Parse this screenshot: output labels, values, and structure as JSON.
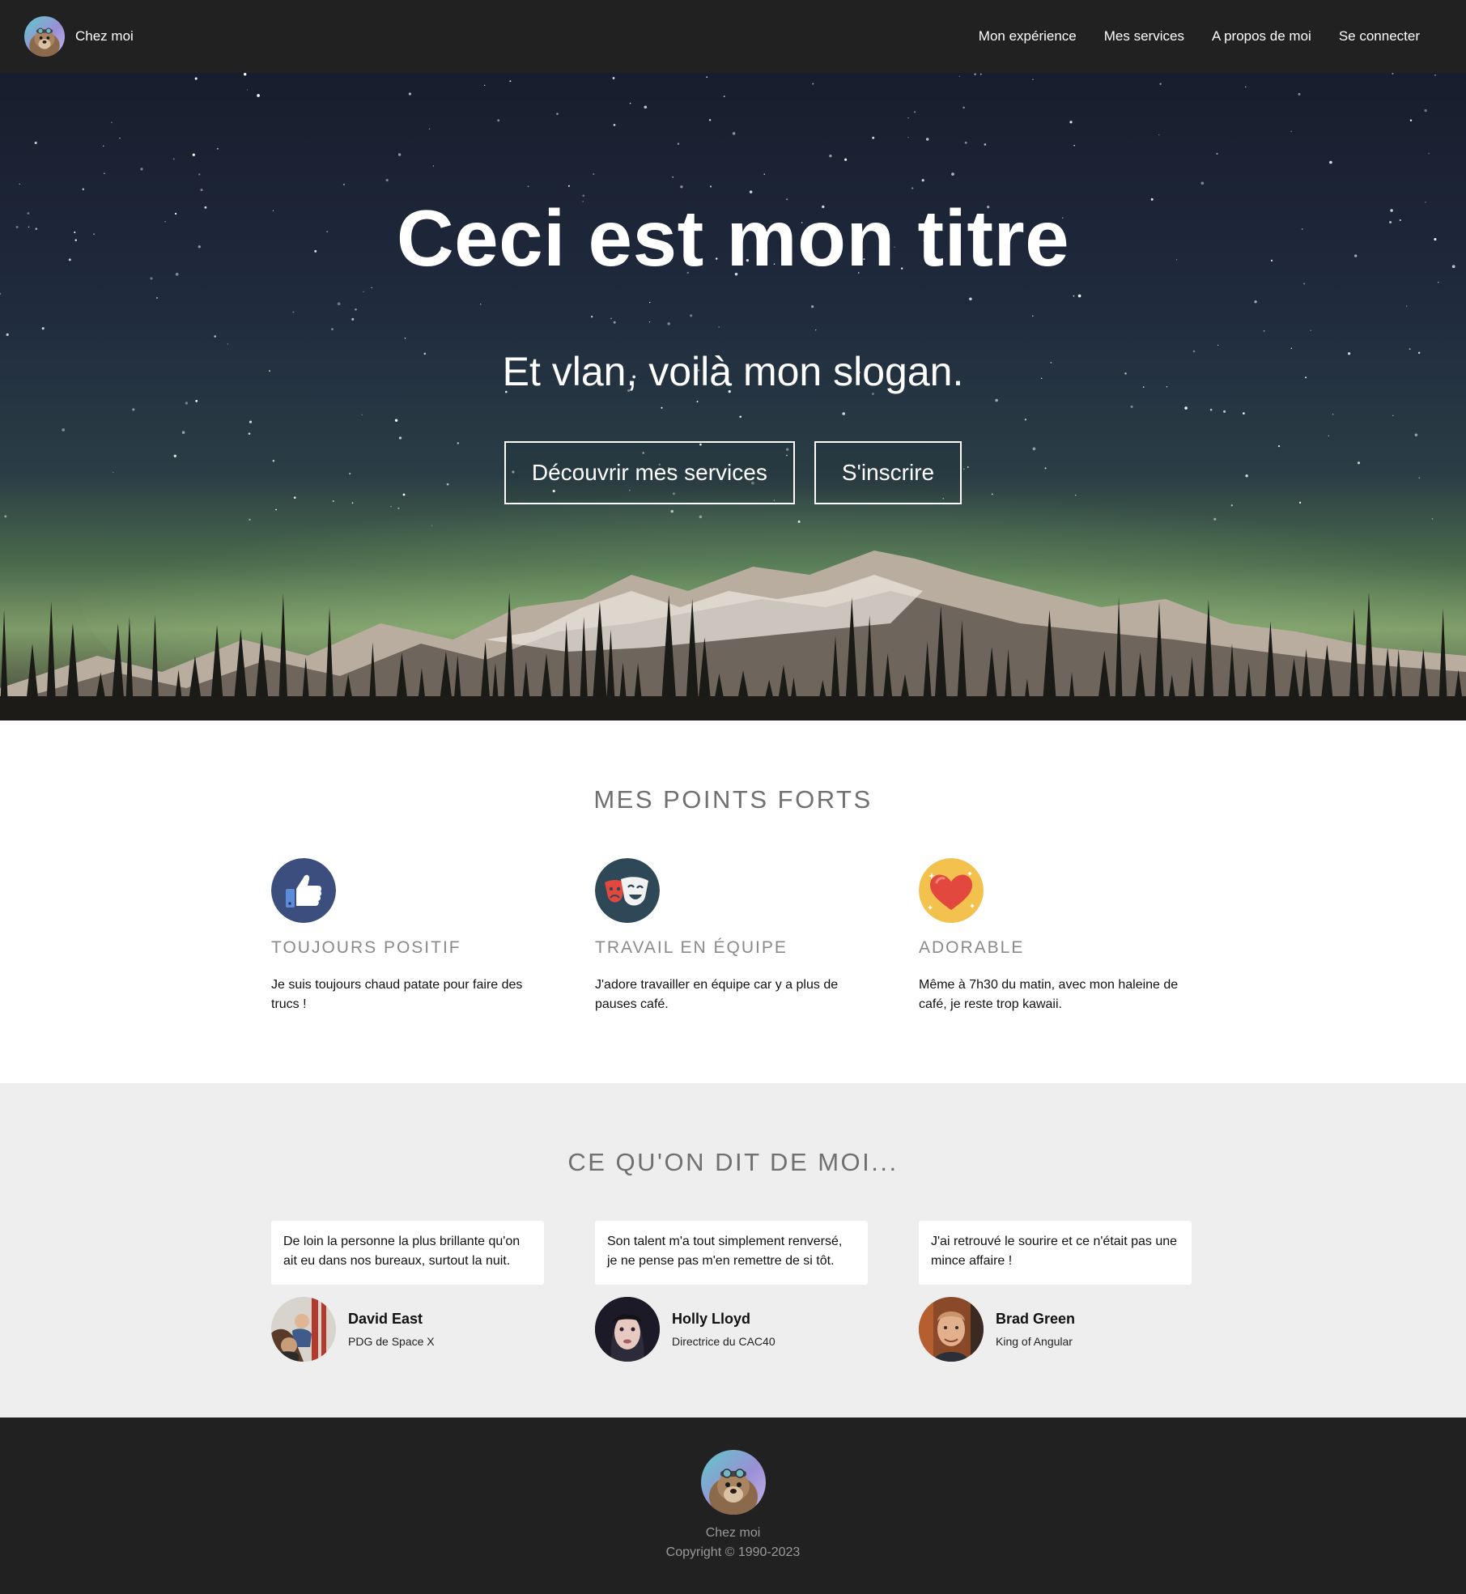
{
  "navbar": {
    "brand_label": "Chez moi",
    "brand_avatar": "hedgehog-avatar",
    "links": [
      "Mon expérience",
      "Mes services",
      "A propos de moi",
      "Se connecter"
    ]
  },
  "hero": {
    "title": "Ceci est mon titre",
    "slogan": "Et vlan, voilà mon slogan.",
    "buttons": [
      "Découvrir mes services",
      "S'inscrire"
    ],
    "background": "night-sky-aurora-mountains"
  },
  "strengths": {
    "title": "MES POINTS FORTS",
    "items": [
      {
        "icon": "thumbs-up-icon",
        "title": "TOUJOURS POSITIF",
        "text": "Je suis toujours chaud patate pour faire des trucs !"
      },
      {
        "icon": "theater-masks-icon",
        "title": "TRAVAIL EN ÉQUIPE",
        "text": "J'adore travailler en équipe car y a plus de pauses café."
      },
      {
        "icon": "heart-icon",
        "title": "ADORABLE",
        "text": "Même à 7h30 du matin, avec mon haleine de café, je reste trop kawaii."
      }
    ]
  },
  "testimonials": {
    "title": "CE QU'ON DIT DE MOI...",
    "items": [
      {
        "quote": "De loin la personne la plus brillante qu'on ait eu dans nos bureaux, surtout la nuit.",
        "name": "David East",
        "role": "PDG de Space X"
      },
      {
        "quote": "Son talent m'a tout simplement renversé, je ne pense pas m'en remettre de si tôt.",
        "name": "Holly Lloyd",
        "role": "Directrice du CAC40"
      },
      {
        "quote": "J'ai retrouvé le sourire et ce n'était pas une mince affaire !",
        "name": "Brad Green",
        "role": "King of Angular"
      }
    ]
  },
  "footer": {
    "brand_label": "Chez moi",
    "copyright": "Copyright © 1990-2023"
  },
  "colors": {
    "navbar_bg": "#212121",
    "testimonials_bg": "#eeeeee",
    "section_title": "#707070",
    "feature_title": "#8a8a8a",
    "thumbs_icon_bg": "#3b4e7e",
    "masks_icon_bg": "#2f4858",
    "heart_icon_bg": "#f2c14e"
  }
}
